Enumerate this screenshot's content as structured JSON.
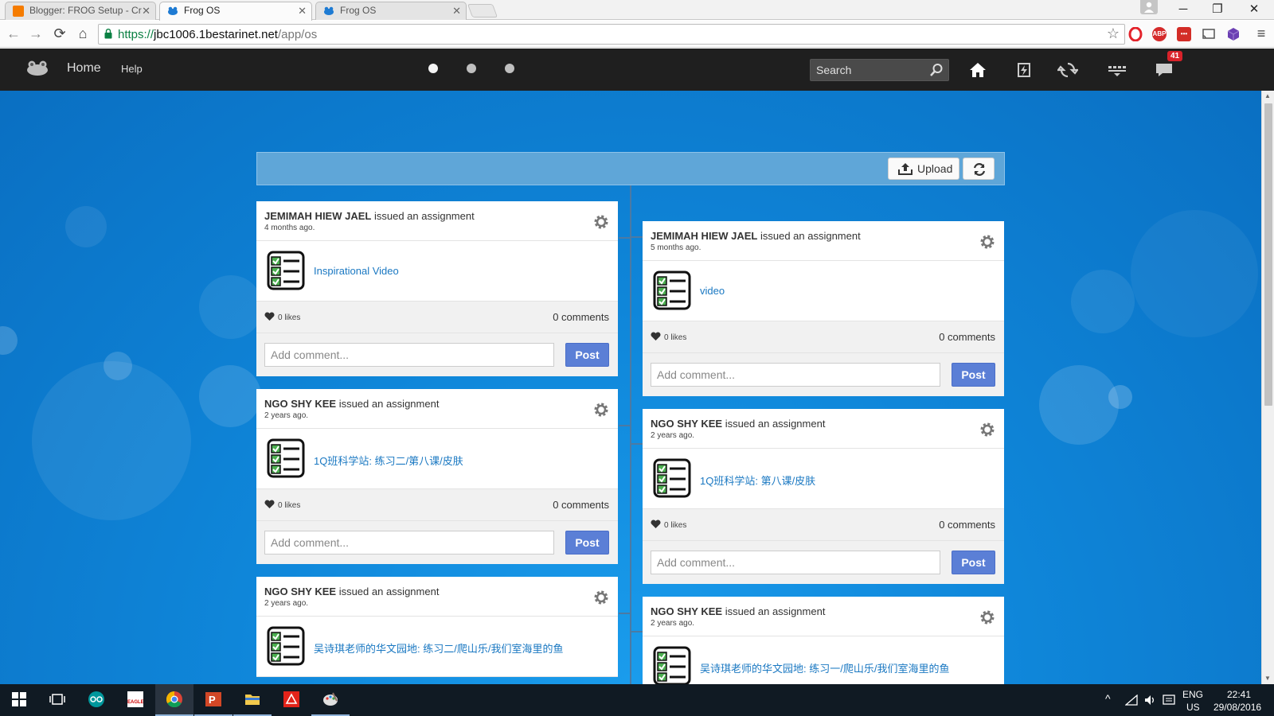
{
  "browser": {
    "tabs": [
      {
        "title": "Blogger: FROG Setup - Cr",
        "active": false,
        "favicon_color": "#f57c00"
      },
      {
        "title": "Frog OS",
        "active": true,
        "favicon_color": "#1e7bd3"
      },
      {
        "title": "Frog OS",
        "active": false,
        "favicon_color": "#1e7bd3"
      }
    ],
    "url": {
      "scheme": "https://",
      "host": "jbc1006.1bestarinet.net",
      "path": "/app/os"
    },
    "extensions": [
      "opera-icon",
      "adblock-plus-icon",
      "lastpass-icon",
      "cast-icon",
      "cube-icon"
    ],
    "adblock_label": "ABP"
  },
  "app": {
    "nav": {
      "home": "Home",
      "help": "Help"
    },
    "search_placeholder": "Search",
    "notification_count": "41",
    "upload_label": "Upload",
    "colors": {
      "header": "#1f1f1f",
      "background": "#0f86d9",
      "post_button": "#5b7fd6",
      "link": "#1a78c2",
      "badge": "#d9222a"
    }
  },
  "feed": {
    "left": [
      {
        "author": "JEMIMAH HIEW JAEL",
        "verb": "issued an assignment",
        "when": "4 months ago.",
        "title": "Inspirational Video",
        "likes": "0 likes",
        "comments": "0 comments",
        "comment_placeholder": "Add comment...",
        "post_label": "Post"
      },
      {
        "author": "NGO SHY KEE",
        "verb": "issued an assignment",
        "when": "2 years ago.",
        "title": "1Q班科学站: 练习二/第八课/皮肤",
        "likes": "0 likes",
        "comments": "0 comments",
        "comment_placeholder": "Add comment...",
        "post_label": "Post"
      },
      {
        "author": "NGO SHY KEE",
        "verb": "issued an assignment",
        "when": "2 years ago.",
        "title": "吴诗琪老师的华文园地: 练习二/爬山乐/我们室海里的鱼"
      }
    ],
    "right": [
      {
        "author": "JEMIMAH HIEW JAEL",
        "verb": "issued an assignment",
        "when": "5 months ago.",
        "title": "video",
        "likes": "0 likes",
        "comments": "0 comments",
        "comment_placeholder": "Add comment...",
        "post_label": "Post"
      },
      {
        "author": "NGO SHY KEE",
        "verb": "issued an assignment",
        "when": "2 years ago.",
        "title": "1Q班科学站: 第八课/皮肤",
        "likes": "0 likes",
        "comments": "0 comments",
        "comment_placeholder": "Add comment...",
        "post_label": "Post"
      },
      {
        "author": "NGO SHY KEE",
        "verb": "issued an assignment",
        "when": "2 years ago.",
        "title": "吴诗琪老师的华文园地: 练习一/爬山乐/我们室海里的鱼"
      }
    ]
  },
  "taskbar": {
    "apps": [
      "start-icon",
      "task-view-icon",
      "arduino-icon",
      "eagle-icon",
      "chrome-icon",
      "powerpoint-icon",
      "file-explorer-icon",
      "acrobat-icon",
      "paint-icon"
    ],
    "eagle_label": "EAGLE",
    "tray": {
      "lang_1": "ENG",
      "lang_2": "US",
      "time": "22:41",
      "date": "29/08/2016"
    }
  }
}
